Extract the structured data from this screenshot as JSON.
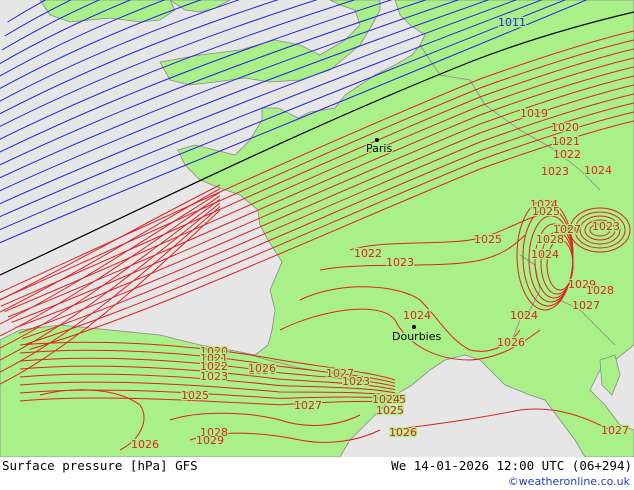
{
  "map": {
    "colors": {
      "sea": "#e6e6e6",
      "land": "#aaf088",
      "coast": "#8a8a8a",
      "isobar_low": "#2222dd",
      "isobar_high": "#dd2222",
      "isobar_ref": "#000000"
    },
    "cities": [
      {
        "name": "Paris"
      },
      {
        "name": "Dourbies"
      }
    ],
    "isobar_labels": [
      "1011",
      "1019",
      "1020",
      "1021",
      "1022",
      "1023",
      "1024",
      "1024",
      "1025",
      "1025",
      "1022",
      "1023",
      "1024",
      "1026",
      "1027",
      "1028",
      "1029",
      "1028",
      "1027",
      "1024",
      "1026",
      "1025",
      "1020",
      "1021",
      "1022",
      "1023",
      "1026",
      "1027",
      "1023",
      "1025",
      "1027",
      "1024",
      "1025",
      "1026",
      "1026",
      "1028",
      "1029",
      "1027",
      "1024",
      "1023"
    ]
  },
  "footer": {
    "title": "Surface pressure [hPa] GFS",
    "valid": "We 14-01-2026 12:00 UTC (06+294)",
    "credit": "©weatheronline.co.uk"
  }
}
